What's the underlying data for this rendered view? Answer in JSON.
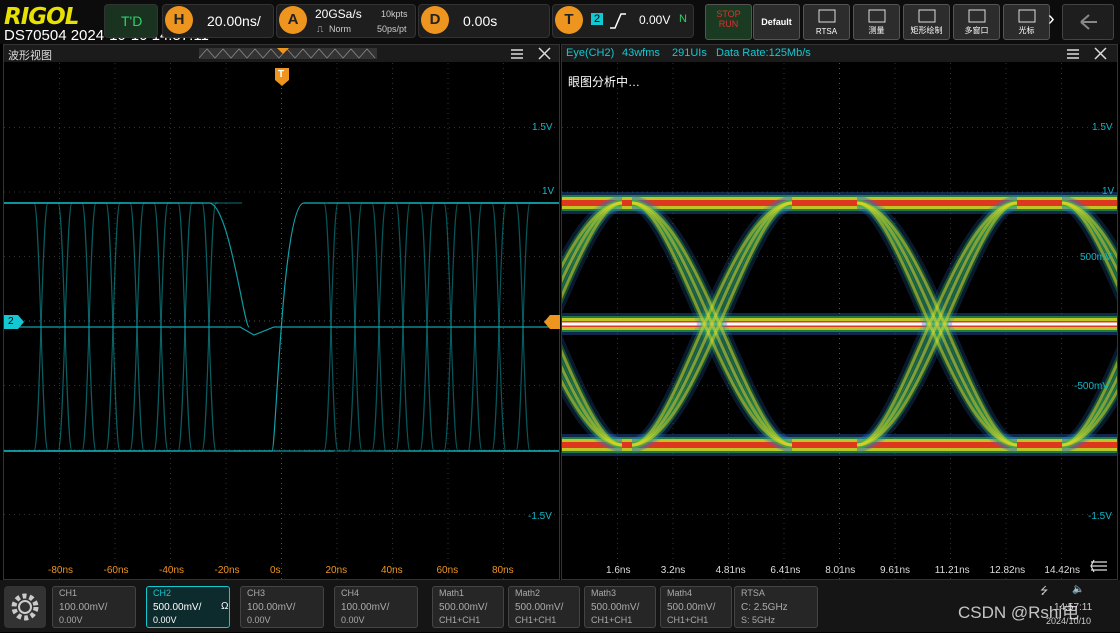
{
  "topbar": {
    "brand": "RIGOL",
    "model_datetime": "DS70504 2024-10-10 14:57:11",
    "trigger_status": "T'D",
    "horizontal": {
      "badge": "H",
      "value": "20.00ns/"
    },
    "acquire": {
      "badge": "A",
      "sample_rate": "20GSa/s",
      "mode": "Norm",
      "memory": "10kpts",
      "sample_period": "50ps/pt"
    },
    "delay": {
      "badge": "D",
      "value": "0.00s"
    },
    "trigger": {
      "badge": "T",
      "channel": "2",
      "level": "0.00V",
      "coupling": "N"
    },
    "buttons": [
      {
        "label": "STOP RUN",
        "icon": "stop-run-icon"
      },
      {
        "label": "Default",
        "icon": "default-icon"
      },
      {
        "label": "RTSA",
        "icon": "rtsa-icon"
      },
      {
        "label": "测量",
        "icon": "measure-icon"
      },
      {
        "label": "矩形绘制",
        "icon": "rect-draw-icon"
      },
      {
        "label": "多窗口",
        "icon": "multiwindow-icon"
      },
      {
        "label": "光标",
        "icon": "cursor-icon"
      }
    ],
    "more_arrow": "›"
  },
  "left_pane": {
    "title": "波形视图",
    "trigger_marker": "T",
    "channel_marker": "2",
    "y_labels": [
      "1.5V",
      "1V",
      "-1.5V"
    ],
    "x_labels": [
      "-80ns",
      "-60ns",
      "-40ns",
      "-20ns",
      "0s",
      "20ns",
      "40ns",
      "60ns",
      "80ns"
    ]
  },
  "right_pane": {
    "title": "Eye(CH2)",
    "waveforms": "43wfms",
    "ui_count": "291UIs",
    "data_rate": "Data Rate:125Mb/s",
    "status": "眼图分析中…",
    "y_labels": [
      "1.5V",
      "1V",
      "500mV",
      "-500mV",
      "-1.5V"
    ],
    "x_labels": [
      "1.6ns",
      "3.2ns",
      "4.81ns",
      "6.41ns",
      "8.01ns",
      "9.61ns",
      "11.21ns",
      "12.82ns",
      "14.42ns"
    ]
  },
  "bottombar": {
    "channels": [
      {
        "name": "CH1",
        "scale": "100.00mV/",
        "offset": "0.00V"
      },
      {
        "name": "CH2",
        "scale": "500.00mV/",
        "offset": "0.00V",
        "impedance": "Ω"
      },
      {
        "name": "CH3",
        "scale": "100.00mV/",
        "offset": "0.00V"
      },
      {
        "name": "CH4",
        "scale": "100.00mV/",
        "offset": "0.00V"
      }
    ],
    "math": [
      {
        "name": "Math1",
        "value": "500.00mV/",
        "source": "CH1+CH1"
      },
      {
        "name": "Math2",
        "value": "500.00mV/",
        "source": "CH1+CH1"
      },
      {
        "name": "Math3",
        "value": "500.00mV/",
        "source": "CH1+CH1"
      },
      {
        "name": "Math4",
        "value": "500.00mV/",
        "source": "CH1+CH1"
      }
    ],
    "rtsa": {
      "name": "RTSA",
      "center": "C: 2.5GHz",
      "span": "S: 5GHz"
    },
    "clock_time": "14:57:11",
    "clock_date": "2024/10/10",
    "watermark": "CSDN @Rshi电"
  },
  "colors": {
    "accent": "#ee9520",
    "ch2": "#14c8d2",
    "brand": "#e8e000"
  }
}
